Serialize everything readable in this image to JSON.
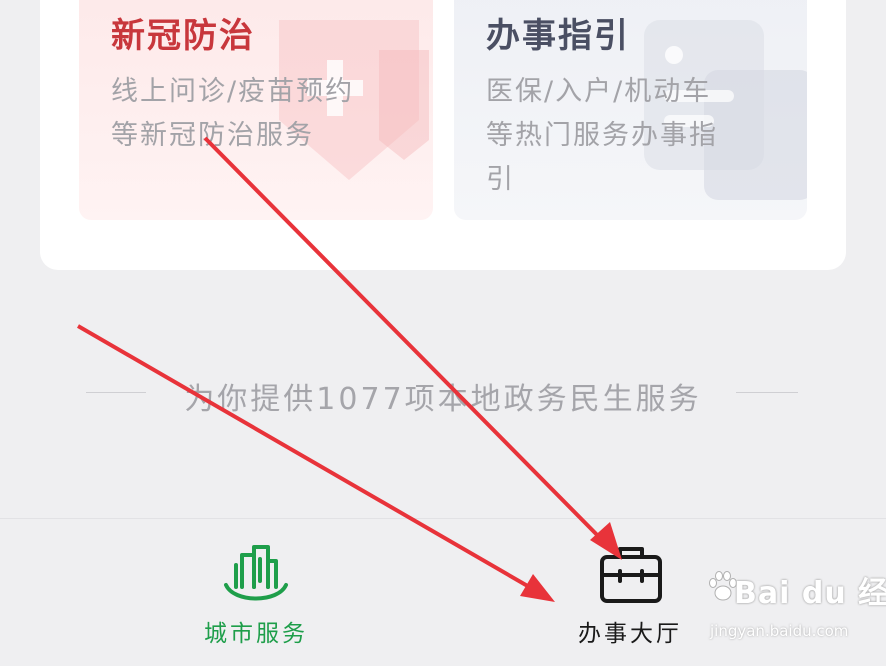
{
  "services_card": {
    "covid": {
      "title": "新冠防治",
      "description": "线上问诊/疫苗预约等新冠防治服务"
    },
    "guide": {
      "title": "办事指引",
      "description": "医保/入户/机动车等热门服务办事指引"
    }
  },
  "footer": {
    "summary": "为你提供1077项本地政务民生服务"
  },
  "tabbar": {
    "city_services_label": "城市服务",
    "service_hall_label": "办事大厅"
  },
  "colors": {
    "covid_accent": "#c8373c",
    "active_tab": "#1e9e4a",
    "arrow": "#e8333a"
  },
  "watermark": {
    "brand": "Bai du 经验",
    "url": "jingyan.baidu.com"
  }
}
